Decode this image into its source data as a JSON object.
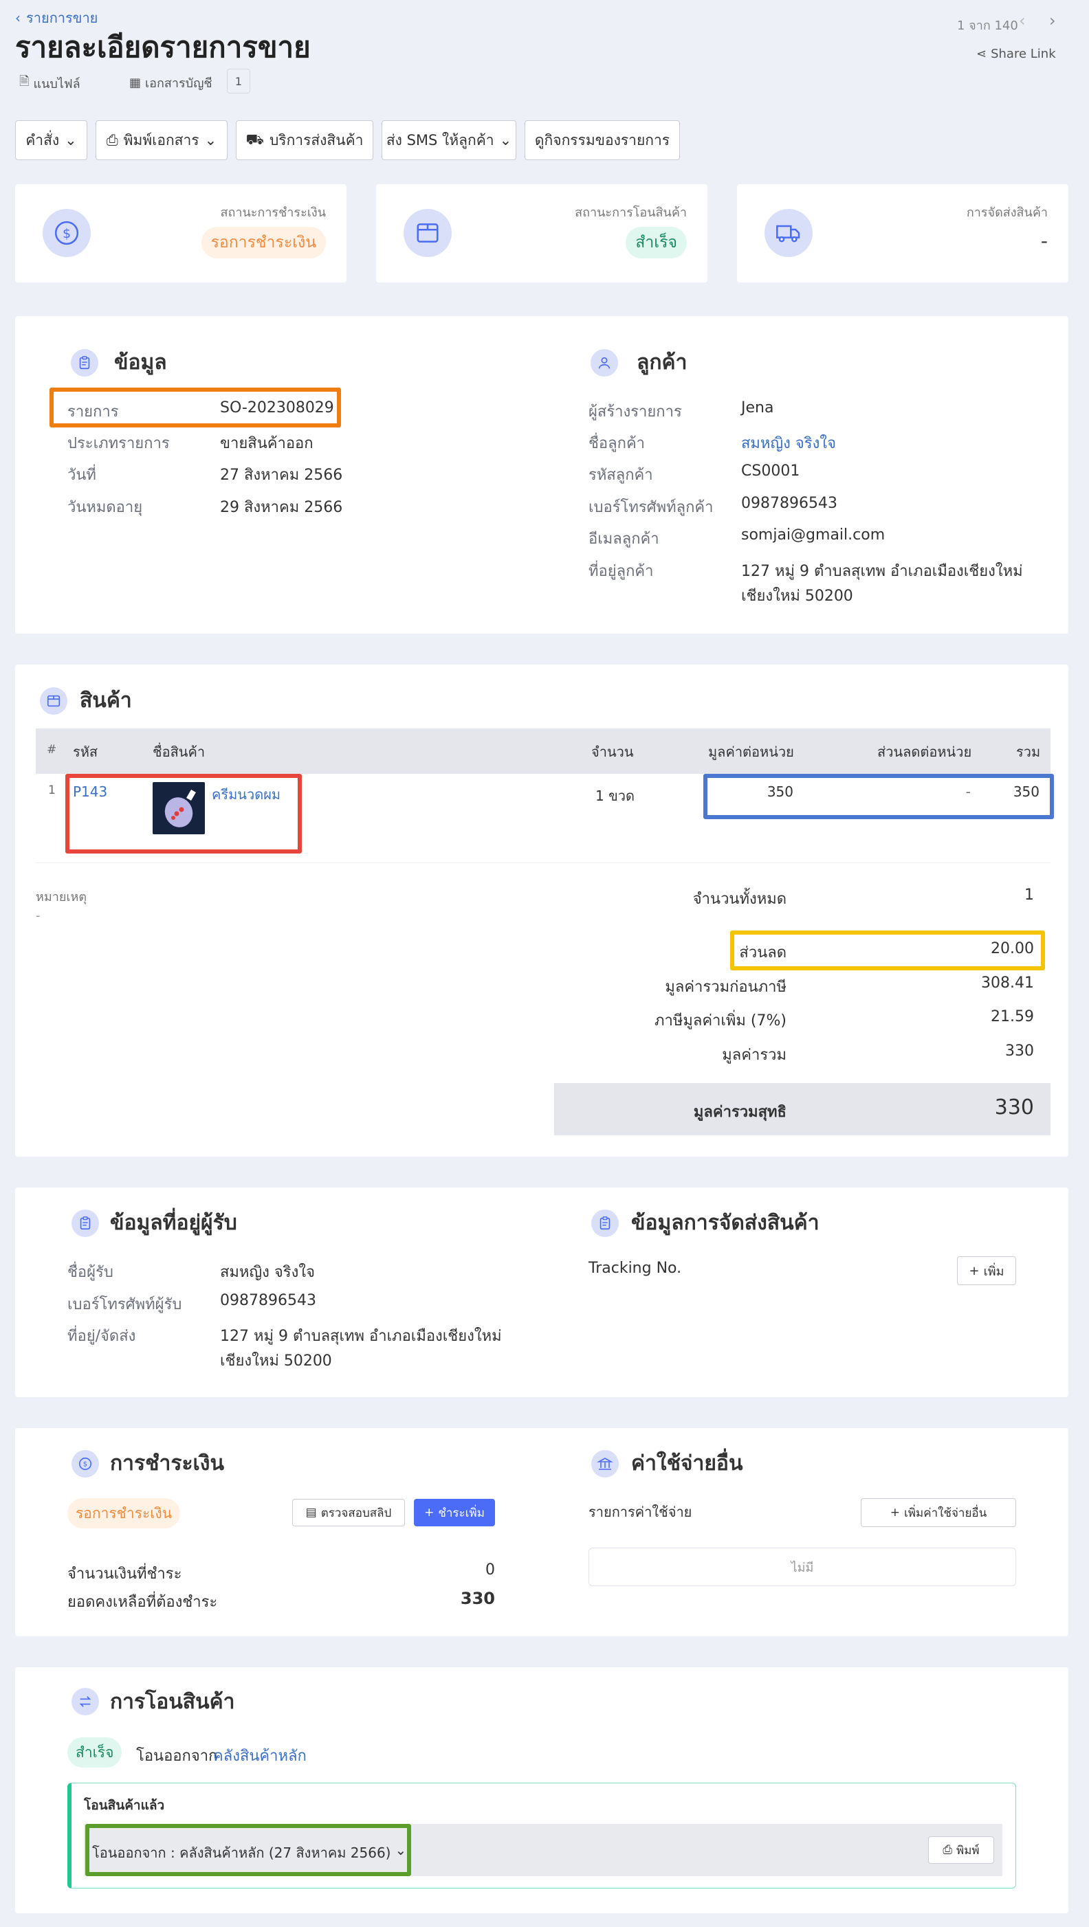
{
  "header": {
    "breadcrumb": "รายการขาย",
    "title": "รายละเอียดรายการขาย",
    "attach_label": "แนบไฟล์",
    "accounting_label": "เอกสารบัญชี",
    "accounting_count": "1",
    "pager": "1 จาก 140",
    "share_label": "Share Link"
  },
  "toolbar": {
    "command": "คำสั่ง",
    "print": "พิมพ์เอกสาร",
    "shipping": "บริการส่งสินค้า",
    "sms": "ส่ง SMS ให้ลูกค้า",
    "activity": "ดูกิจกรรมของรายการ"
  },
  "status": {
    "payment": {
      "label": "สถานะการชำระเงิน",
      "value": "รอการชำระเงิน"
    },
    "transfer": {
      "label": "สถานะการโอนสินค้า",
      "value": "สำเร็จ"
    },
    "shipping": {
      "label": "การจัดส่งสินค้า",
      "value": "-"
    }
  },
  "info": {
    "title": "ข้อมูล",
    "rows": [
      {
        "label": "รายการ",
        "value": "SO-202308029"
      },
      {
        "label": "ประเภทรายการ",
        "value": "ขายสินค้าออก"
      },
      {
        "label": "วันที่",
        "value": "27 สิงหาคม 2566"
      },
      {
        "label": "วันหมดอายุ",
        "value": "29 สิงหาคม 2566"
      }
    ]
  },
  "customer": {
    "title": "ลูกค้า",
    "rows": [
      {
        "label": "ผู้สร้างรายการ",
        "value": "Jena"
      },
      {
        "label": "ชื่อลูกค้า",
        "value": "สมหญิง จริงใจ"
      },
      {
        "label": "รหัสลูกค้า",
        "value": "CS0001"
      },
      {
        "label": "เบอร์โทรศัพท์ลูกค้า",
        "value": "0987896543"
      },
      {
        "label": "อีเมลลูกค้า",
        "value": "somjai@gmail.com"
      },
      {
        "label": "ที่อยู่ลูกค้า",
        "value": "127 หมู่ 9 ตำบลสุเทพ อำเภอเมืองเชียงใหม่"
      }
    ],
    "address_line2": "เชียงใหม่ 50200"
  },
  "products": {
    "title": "สินค้า",
    "columns": [
      "#",
      "รหัส",
      "ชื่อสินค้า",
      "จำนวน",
      "มูลค่าต่อหน่วย",
      "ส่วนลดต่อหน่วย",
      "รวม"
    ],
    "rows": [
      {
        "no": "1",
        "code": "P143",
        "name": "ครีมนวดผม",
        "qty": "1 ขวด",
        "unit_price": "350",
        "discount": "-",
        "total": "350"
      }
    ],
    "note_label": "หมายเหตุ",
    "note_value": "-",
    "summary": {
      "count_label": "จำนวนทั้งหมด",
      "count": "1",
      "discount_label": "ส่วนลด",
      "discount": "20.00",
      "pretax_label": "มูลค่ารวมก่อนภาษี",
      "pretax": "308.41",
      "vat_label": "ภาษีมูลค่าเพิ่ม (7%)",
      "vat": "21.59",
      "total_label": "มูลค่ารวม",
      "total": "330",
      "net_label": "มูลค่ารวมสุทธิ",
      "net": "330"
    }
  },
  "recipient": {
    "title": "ข้อมูลที่อยู่ผู้รับ",
    "rows": [
      {
        "label": "ชื่อผู้รับ",
        "value": "สมหญิง จริงใจ"
      },
      {
        "label": "เบอร์โทรศัพท์ผู้รับ",
        "value": "0987896543"
      },
      {
        "label": "ที่อยู่/จัดส่ง",
        "value": "127 หมู่ 9 ตำบลสุเทพ อำเภอเมืองเชียงใหม่"
      }
    ],
    "address_line2": "เชียงใหม่ 50200"
  },
  "shipping_info": {
    "title": "ข้อมูลการจัดส่งสินค้า",
    "tracking_label": "Tracking No.",
    "add_label": "เพิ่ม"
  },
  "payment": {
    "title": "การชำระเงิน",
    "status": "รอการชำระเงิน",
    "check_slip": "ตรวจสอบสลิป",
    "pay_more": "ชำระเพิ่ม",
    "paid_label": "จำนวนเงินที่ชำระ",
    "paid": "0",
    "balance_label": "ยอดคงเหลือที่ต้องชำระ",
    "balance": "330"
  },
  "expenses": {
    "title": "ค่าใช้จ่ายอื่น",
    "list_label": "รายการค่าใช้จ่าย",
    "add_label": "เพิ่มค่าใช้จ่ายอื่น",
    "empty": "ไม่มี"
  },
  "transfer": {
    "title": "การโอนสินค้า",
    "status": "สำเร็จ",
    "from_label": "โอนออกจาก",
    "warehouse": "คลังสินค้าหลัก",
    "panel_title": "โอนสินค้าแล้ว",
    "detail": "โอนออกจาก : คลังสินค้าหลัก (27 สิงหาคม 2566)",
    "print_label": "พิมพ์"
  },
  "colors": {
    "accent": "#3a6fc4",
    "primary_button": "#4a6cf7",
    "pending": "#f08a3e",
    "success": "#1aaa7a",
    "highlight_orange": "#f07d12",
    "highlight_red": "#e8453c",
    "highlight_blue": "#4a78d0",
    "highlight_yellow": "#f5c400",
    "highlight_green": "#5b9e2a"
  }
}
